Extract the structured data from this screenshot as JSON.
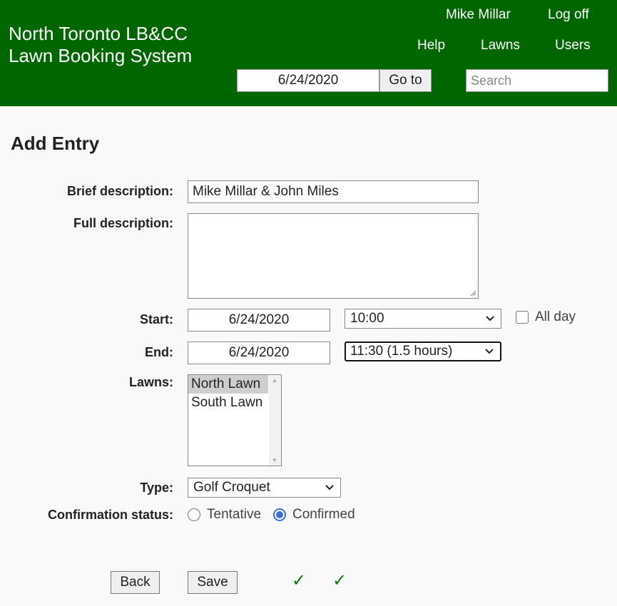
{
  "header": {
    "site_title_line1": "North Toronto LB&CC",
    "site_title_line2": "Lawn Booking System",
    "user_name": "Mike Millar",
    "logoff_label": "Log off",
    "help_label": "Help",
    "lawns_label": "Lawns",
    "users_label": "Users",
    "date_value": "6/24/2020",
    "goto_label": "Go to",
    "search_placeholder": "Search"
  },
  "page_title": "Add Entry",
  "form": {
    "brief_label": "Brief description:",
    "brief_value": "Mike Millar & John Miles",
    "full_label": "Full description:",
    "full_value": "",
    "start_label": "Start:",
    "start_date": "6/24/2020",
    "start_time": "10:00",
    "allday_label": "All day",
    "end_label": "End:",
    "end_date": "6/24/2020",
    "end_time": "11:30  (1.5 hours)",
    "lawns_label": "Lawns:",
    "lawns_options": [
      "North Lawn",
      "South Lawn"
    ],
    "type_label": "Type:",
    "type_value": "Golf Croquet",
    "confirmation_label": "Confirmation status:",
    "tentative_label": "Tentative",
    "confirmed_label": "Confirmed"
  },
  "buttons": {
    "back_label": "Back",
    "save_label": "Save"
  },
  "icons": {
    "check_mark": "check-icon",
    "chevron": "chevron-down-icon"
  }
}
